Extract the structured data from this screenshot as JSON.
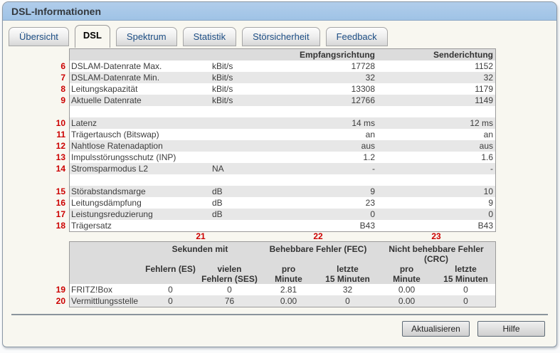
{
  "window": {
    "title": "DSL-Informationen"
  },
  "tabs": [
    {
      "label": "Übersicht",
      "active": false
    },
    {
      "label": "DSL",
      "active": true
    },
    {
      "label": "Spektrum",
      "active": false
    },
    {
      "label": "Statistik",
      "active": false
    },
    {
      "label": "Störsicherheit",
      "active": false
    },
    {
      "label": "Feedback",
      "active": false
    }
  ],
  "table1": {
    "col_headers": {
      "rx": "Empfangsrichtung",
      "tx": "Senderichtung"
    },
    "groups": [
      {
        "rows": [
          {
            "num": "6",
            "label": "DSLAM-Datenrate Max.",
            "unit": "kBit/s",
            "rx": "17728",
            "tx": "1152"
          },
          {
            "num": "7",
            "label": "DSLAM-Datenrate Min.",
            "unit": "kBit/s",
            "rx": "32",
            "tx": "32"
          },
          {
            "num": "8",
            "label": "Leitungskapazität",
            "unit": "kBit/s",
            "rx": "13308",
            "tx": "1179"
          },
          {
            "num": "9",
            "label": "Aktuelle Datenrate",
            "unit": "kBit/s",
            "rx": "12766",
            "tx": "1149"
          }
        ]
      },
      {
        "rows": [
          {
            "num": "10",
            "label": "Latenz",
            "unit": "",
            "rx": "14 ms",
            "tx": "12 ms"
          },
          {
            "num": "11",
            "label": "Trägertausch (Bitswap)",
            "unit": "",
            "rx": "an",
            "tx": "an"
          },
          {
            "num": "12",
            "label": "Nahtlose Ratenadaption",
            "unit": "",
            "rx": "aus",
            "tx": "aus"
          },
          {
            "num": "13",
            "label": "Impulsstörungsschutz (INP)",
            "unit": "",
            "rx": "1.2",
            "tx": "1.6"
          },
          {
            "num": "14",
            "label": "Stromsparmodus L2",
            "unit": "NA",
            "rx": "-",
            "tx": "-"
          }
        ]
      },
      {
        "rows": [
          {
            "num": "15",
            "label": "Störabstandsmarge",
            "unit": "dB",
            "rx": "9",
            "tx": "10"
          },
          {
            "num": "16",
            "label": "Leitungsdämpfung",
            "unit": "dB",
            "rx": "23",
            "tx": "9"
          },
          {
            "num": "17",
            "label": "Leistungsreduzierung",
            "unit": "dB",
            "rx": "0",
            "tx": "0"
          },
          {
            "num": "18",
            "label": "Trägersatz",
            "unit": "",
            "rx": "B43",
            "tx": "B43"
          }
        ]
      }
    ]
  },
  "table2": {
    "group_numbers": [
      "21",
      "22",
      "23"
    ],
    "group_headers": [
      "Sekunden mit",
      "Behebbare Fehler (FEC)",
      "Nicht behebbare Fehler (CRC)"
    ],
    "sub_headers": [
      "Fehlern (ES)\n",
      "vielen\nFehlern (SES)",
      "pro\nMinute",
      "letzte\n15 Minuten",
      "pro\nMinute",
      "letzte\n15 Minuten"
    ],
    "rows": [
      {
        "num": "19",
        "label": "FRITZ!Box",
        "values": [
          "0",
          "0",
          "2.81",
          "32",
          "0.00",
          "0"
        ]
      },
      {
        "num": "20",
        "label": "Vermittlungsstelle",
        "values": [
          "0",
          "76",
          "0.00",
          "0",
          "0.00",
          "0"
        ]
      }
    ]
  },
  "buttons": {
    "refresh": "Aktualisieren",
    "help": "Hilfe"
  }
}
